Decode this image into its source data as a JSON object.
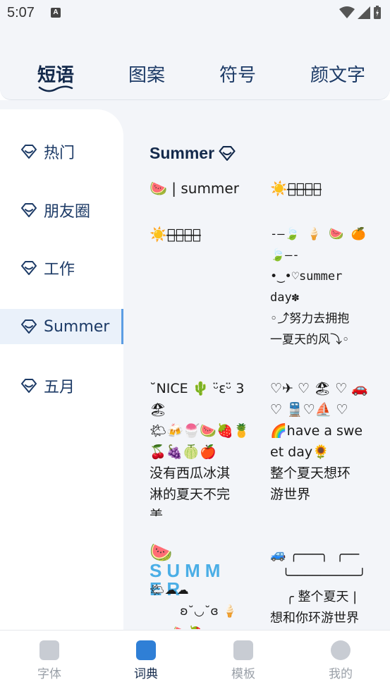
{
  "status_bar": {
    "time": "5:07",
    "a_icon": "A"
  },
  "top_tabs": [
    {
      "label": "短语"
    },
    {
      "label": "图案"
    },
    {
      "label": "符号"
    },
    {
      "label": "颜文字"
    }
  ],
  "sidebar": {
    "items": [
      {
        "label": "热门"
      },
      {
        "label": "朋友圈"
      },
      {
        "label": "工作"
      },
      {
        "label": "Summer"
      },
      {
        "label": "五月"
      }
    ]
  },
  "content": {
    "title": "Summer",
    "phrases": [
      "🍉 | summer",
      "☀️热̶̶到̶̶冒̶̶烟̶",
      "☀️热̶̶到̶̶冒̶̶汗̶",
      "-—🍃 🍦 🍉 🍊\n🍃—-\n•‿•♡summer\nday✽\n◦⤴努力去拥抱\n一夏天的风⤵◦",
      "˘NICE 🌵 ᵕ̈ɛᵕ̈ 3\n🏖\n🌤🍻🍧🍉🍓🍍\n🍒🍇🍈🍎\n没有西瓜冰淇\n淋的夏天不完\n美",
      "♡✈ ♡ 🏖 ♡ 🚗\n♡ 🚆♡⛵ ♡\n🌈have a swe\net day🌻\n整个夏天想环\n游世界",
      "🍉 SUMM\nER",
      "🌤☁☁\n        ʚ˘◡˘ɞ 🍦\n~~ 🍉🍓",
      "🚙 ╭───╮  ╭──\n   ╰─────────╯\n    ╭ 整个夏天 |\n想和你环游世界"
    ]
  },
  "bottom_nav": [
    {
      "label": "字体",
      "icon": "font-icon"
    },
    {
      "label": "词典",
      "icon": "dictionary-icon"
    },
    {
      "label": "模板",
      "icon": "template-icon"
    },
    {
      "label": "我的",
      "icon": "profile-icon"
    }
  ],
  "colors": {
    "accent": "#13294b",
    "active_bar": "#5b9de3",
    "background": "#f3f5f9"
  }
}
